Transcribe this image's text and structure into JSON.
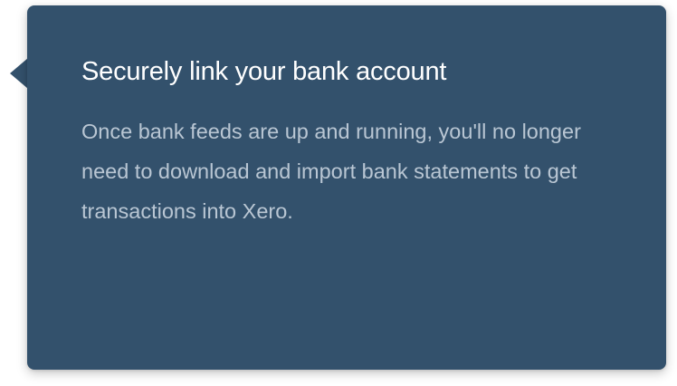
{
  "tooltip": {
    "title": "Securely link your bank account",
    "body": "Once bank feeds are up and running, you'll no longer need to download and import bank statements to get transactions into Xero."
  },
  "colors": {
    "panel": "#33516c",
    "title_text": "#ffffff",
    "body_text": "#b9c6d3"
  }
}
